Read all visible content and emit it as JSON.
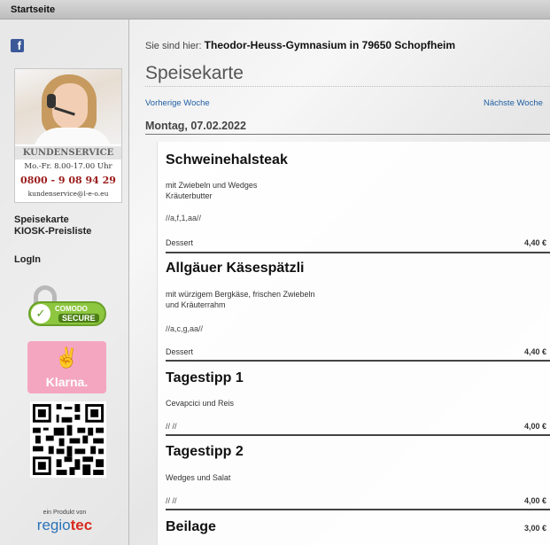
{
  "topbar": {
    "home_label": "Startseite"
  },
  "sidebar": {
    "service": {
      "title": "KUNDENSERVICE",
      "hours": "Mo.-Fr. 8.00-17.00 Uhr",
      "phone": "0800 - 9 08 94 29",
      "email": "kundenservice@l-e-o.eu"
    },
    "links": [
      "Speisekarte",
      "KIOSK-Preisliste",
      "LogIn"
    ],
    "comodo": {
      "line1": "COMODO",
      "line2": "SECURE"
    },
    "klarna": "Klarna.",
    "regio": {
      "sub": "ein Produkt von",
      "name": "regio",
      "suffix": "tec"
    }
  },
  "breadcrumb": {
    "prefix": "Sie sind hier:",
    "location": "Theodor-Heuss-Gymnasium in 79650 Schopfheim"
  },
  "page_title": "Speisekarte",
  "week_nav": {
    "prev": "Vorherige Woche",
    "next": "Nächste Woche"
  },
  "day_header": "Montag, 07.02.2022",
  "dishes": [
    {
      "name": "Schweinehalsteak",
      "desc_line1": "mit Zwiebeln und Wedges",
      "desc_line2": "Kräuterbutter",
      "allergens": "//a,f,1,aa//",
      "dessert": "Dessert",
      "price": "4,40 €"
    },
    {
      "name": "Allgäuer Käsespätzli",
      "desc_line1": "mit würzigem Bergkäse, frischen Zwiebeln",
      "desc_line2": "und Kräuterrahm",
      "allergens": "//a,c,g,aa//",
      "dessert": "Dessert",
      "price": "4,40 €"
    },
    {
      "name": "Tagestipp 1",
      "desc_line1": "Cevapcici und Reis",
      "allergens": "// //",
      "price": "4,00 €"
    },
    {
      "name": "Tagestipp 2",
      "desc_line1": "Wedges und Salat",
      "allergens": "// //",
      "price": "4,00 €"
    },
    {
      "name": "Beilage",
      "price": "3,00 €"
    }
  ],
  "colors": {
    "link": "#1f5fa3",
    "phone": "#9b1c1c",
    "klarna": "#f4a6c1",
    "comodo": "#8dc63f"
  }
}
